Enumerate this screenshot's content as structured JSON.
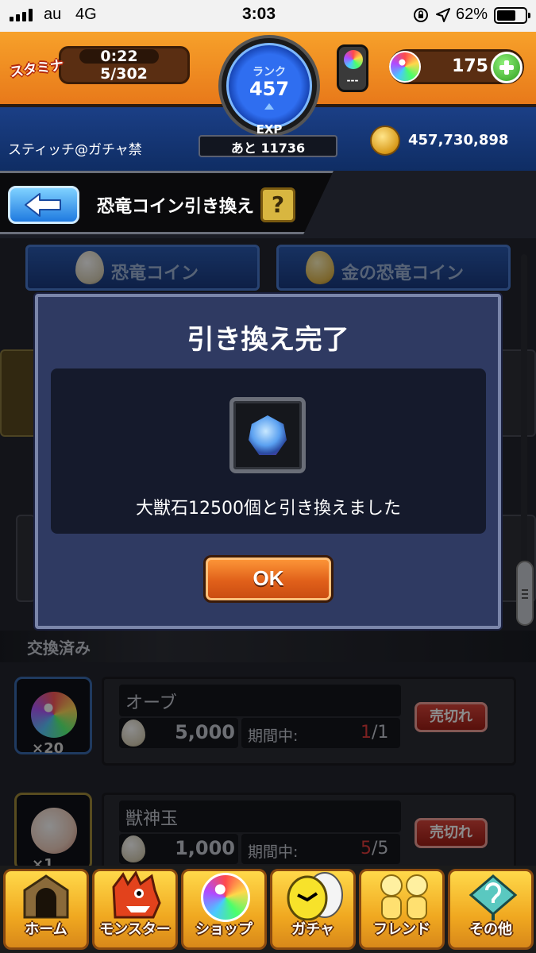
{
  "status_bar": {
    "carrier": "au",
    "network": "4G",
    "time": "3:03",
    "battery_percent": "62%"
  },
  "header": {
    "stamina_label": "スタミナ",
    "stamina_timer": "0:22",
    "stamina_count": "5/302",
    "rank_label": "ランク",
    "rank_value": "457",
    "exp_label": "EXP",
    "exp_remaining": "あと 11736",
    "orb_can_value": "---",
    "orb_count": "175",
    "username": "スティッチ@ガチャ禁",
    "gold": "457,730,898"
  },
  "page": {
    "title": "恐竜コイン引き換え",
    "help": "?"
  },
  "tabs": [
    {
      "label": "恐竜コイン"
    },
    {
      "label": "金の恐竜コイン"
    }
  ],
  "exchanged_section": {
    "label": "交換済み",
    "items": [
      {
        "quantity": "×20",
        "name": "オーブ",
        "price": "5,000",
        "period_label": "期間中:",
        "used": "1",
        "limit": "/1",
        "status": "売切れ"
      },
      {
        "quantity": "×1",
        "name": "獣神玉",
        "price": "1,000",
        "period_label": "期間中:",
        "used": "5",
        "limit": "/5",
        "status": "売切れ"
      }
    ]
  },
  "modal": {
    "title": "引き換え完了",
    "message": "大獣石12500個と引き換えました",
    "ok_label": "OK",
    "reward_icon": "beast-stone-icon"
  },
  "bottom_nav": [
    {
      "label": "ホーム",
      "icon": "home-gate-icon"
    },
    {
      "label": "モンスター",
      "icon": "dragon-icon"
    },
    {
      "label": "ショップ",
      "icon": "orb-icon"
    },
    {
      "label": "ガチャ",
      "icon": "egg-icon"
    },
    {
      "label": "フレンド",
      "icon": "friends-icon"
    },
    {
      "label": "その他",
      "icon": "question-sign-icon"
    }
  ],
  "colors": {
    "header_orange": "#f7a12a",
    "header_blue": "#1b3f86",
    "modal_bg": "#2f3a62",
    "ok_button": "#e0601a",
    "soldout_red": "#c8342a",
    "nav_gold": "#ffd94a"
  }
}
